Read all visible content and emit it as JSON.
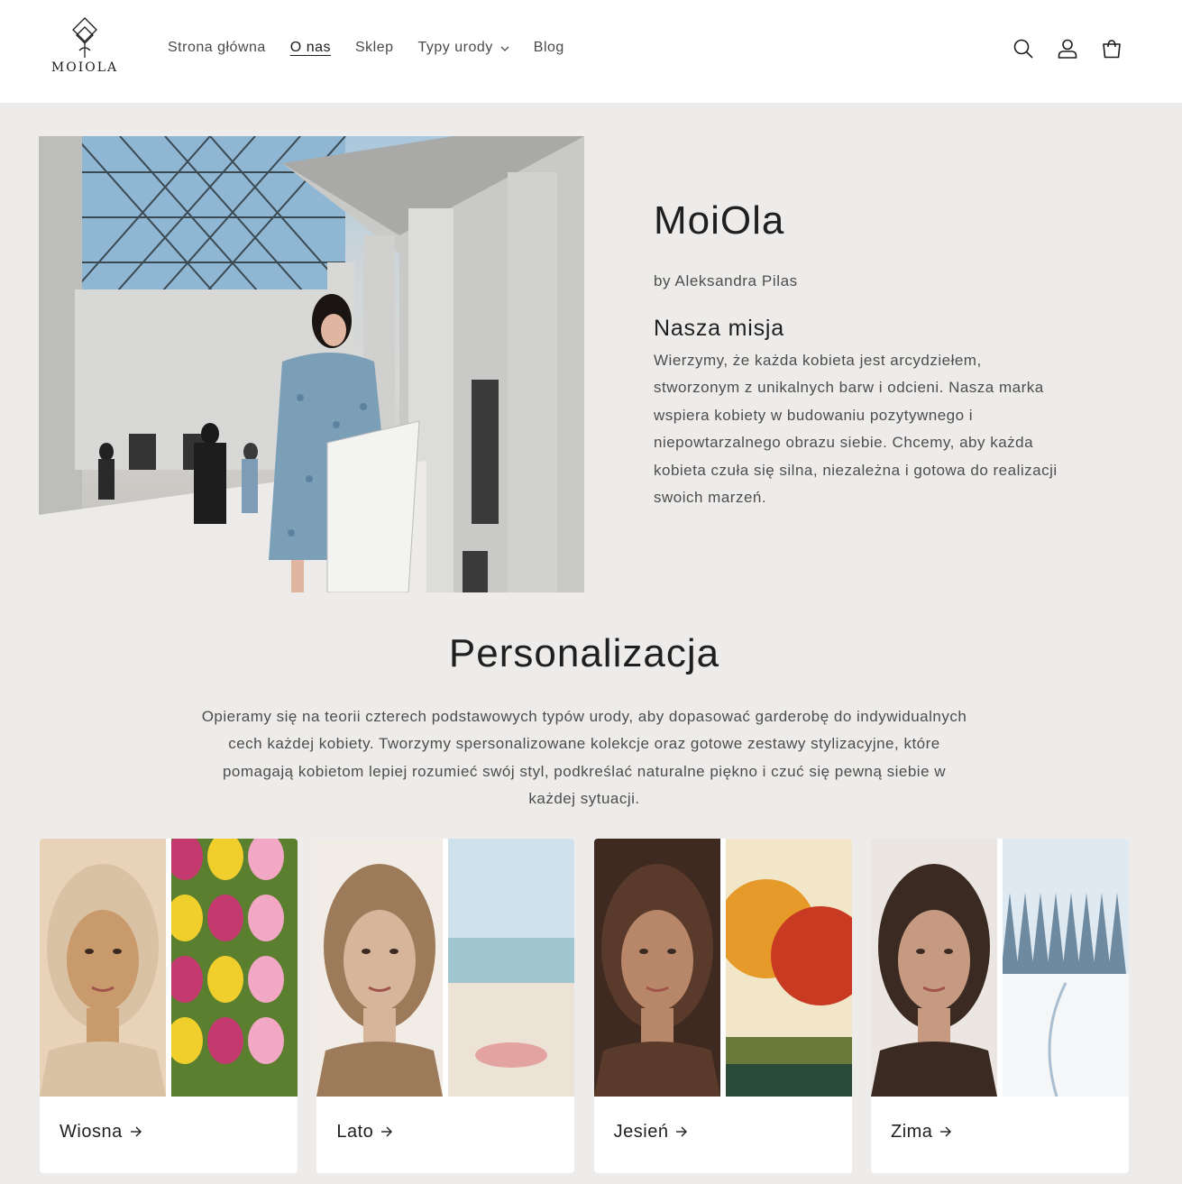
{
  "header": {
    "logo_text": "MOIOLA",
    "nav": [
      {
        "label": "Strona główna"
      },
      {
        "label": "O nas"
      },
      {
        "label": "Sklep"
      },
      {
        "label": "Typy urody"
      },
      {
        "label": "Blog"
      }
    ],
    "icons": [
      "search-icon",
      "account-icon",
      "cart-icon"
    ]
  },
  "hero": {
    "title": "MoiOla",
    "byline": "by Aleksandra Pilas",
    "mission_title": "Nasza misja",
    "mission_body": "Wierzymy, że każda kobieta jest arcydziełem, stworzonym z unikalnych barw i odcieni. Nasza marka wspiera kobiety w budowaniu pozytywnego i niepowtarzalnego obrazu siebie. Chcemy, aby każda kobieta czuła się silna, niezależna i gotowa do realizacji swoich marzeń."
  },
  "personalization": {
    "title": "Personalizacja",
    "body": "Opieramy się na teorii czterech podstawowych typów urody, aby dopasować garderobę do indywidualnych cech każdej kobiety. Tworzymy spersonalizowane kolekcje oraz gotowe zestawy stylizacyjne, które pomagają kobietom lepiej rozumieć swój styl, podkreślać naturalne piękno i czuć się pewną siebie w każdej sytuacji."
  },
  "cards": [
    {
      "label": "Wiosna",
      "face_colors": [
        "#d9c2a3",
        "#c89a6c",
        "#e8d2b8"
      ],
      "scene_colors": [
        "#c43a6e",
        "#f0cf2d",
        "#5a7f2f",
        "#f2a7c4"
      ]
    },
    {
      "label": "Lato",
      "face_colors": [
        "#9c7a5a",
        "#d7b59a",
        "#f1ede6"
      ],
      "scene_colors": [
        "#cfe1ea",
        "#9fc6cf",
        "#ece3d6",
        "#e3a3a0"
      ]
    },
    {
      "label": "Jesień",
      "face_colors": [
        "#5a3a2a",
        "#b8876a",
        "#3e2a20"
      ],
      "scene_colors": [
        "#e59a2a",
        "#c83a22",
        "#6a7a3a",
        "#2a4a3a"
      ]
    },
    {
      "label": "Zima",
      "face_colors": [
        "#3a2a22",
        "#c69a80",
        "#ebe6e2"
      ],
      "scene_colors": [
        "#dfe9f1",
        "#6e8aa0",
        "#f4f6f8",
        "#a9bed0"
      ]
    }
  ],
  "colors": {
    "background": "#eeecea",
    "header_bg": "#ffffff",
    "text_primary": "#1f1f1f",
    "text_secondary": "#4d4d4d"
  }
}
